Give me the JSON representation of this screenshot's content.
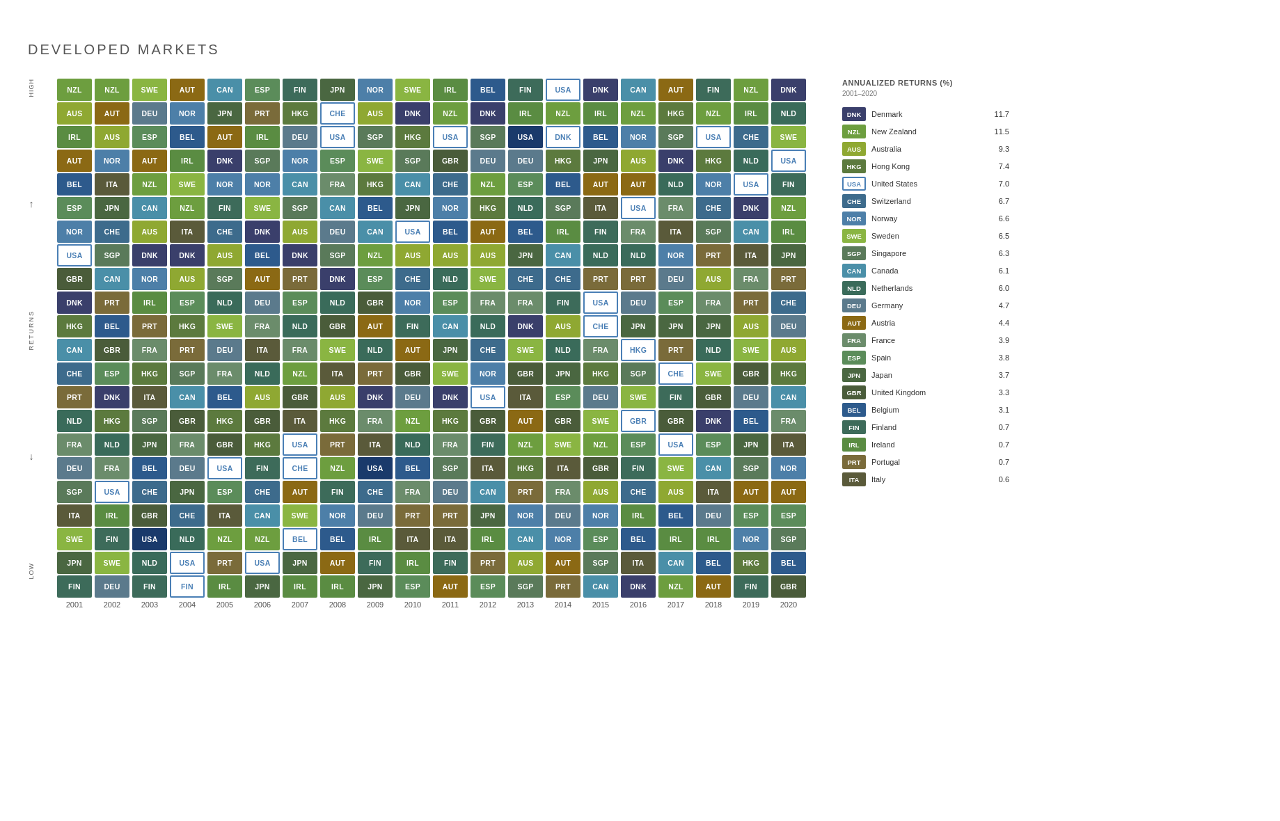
{
  "title": "DEVELOPED MARKETS",
  "yAxis": {
    "top": "HIGH",
    "mid": "RETURNS",
    "bot": "LOW"
  },
  "xLabels": [
    "2001",
    "2002",
    "2003",
    "2004",
    "2005",
    "2006",
    "2007",
    "2008",
    "2009",
    "2010",
    "2011",
    "2012",
    "2013",
    "2014",
    "2015",
    "2016",
    "2017",
    "2018",
    "2019",
    "2020"
  ],
  "legend": {
    "title": "ANNUALIZED RETURNS (%)",
    "subtitle": "2001–2020",
    "items": [
      {
        "code": "DNK",
        "name": "Denmark",
        "value": "11.7",
        "color": "#3a3f6b"
      },
      {
        "code": "NZL",
        "name": "New Zealand",
        "value": "11.5",
        "color": "#6d9e3f"
      },
      {
        "code": "AUS",
        "name": "Australia",
        "value": "9.3",
        "color": "#8fa832"
      },
      {
        "code": "HKG",
        "name": "Hong Kong",
        "value": "7.4",
        "color": "#5c7a3e"
      },
      {
        "code": "USA",
        "name": "United States",
        "value": "7.0",
        "outlined": true
      },
      {
        "code": "CHE",
        "name": "Switzerland",
        "value": "6.7",
        "color": "#3d6b8c"
      },
      {
        "code": "NOR",
        "name": "Norway",
        "value": "6.6",
        "color": "#4d7fa8"
      },
      {
        "code": "SWE",
        "name": "Sweden",
        "value": "6.5",
        "color": "#8ab542"
      },
      {
        "code": "SGP",
        "name": "Singapore",
        "value": "6.3",
        "color": "#5a7a5a"
      },
      {
        "code": "CAN",
        "name": "Canada",
        "value": "6.1",
        "color": "#4a8fa8"
      },
      {
        "code": "NLD",
        "name": "Netherlands",
        "value": "6.0",
        "color": "#3a6b5a"
      },
      {
        "code": "DEU",
        "name": "Germany",
        "value": "4.7",
        "color": "#5b7a8c"
      },
      {
        "code": "AUT",
        "name": "Austria",
        "value": "4.4",
        "color": "#8b6914"
      },
      {
        "code": "FRA",
        "name": "France",
        "value": "3.9",
        "color": "#6b8c6b"
      },
      {
        "code": "ESP",
        "name": "Spain",
        "value": "3.8",
        "color": "#5b8c5a"
      },
      {
        "code": "JPN",
        "name": "Japan",
        "value": "3.7",
        "color": "#4a6741"
      },
      {
        "code": "GBR",
        "name": "United Kingdom",
        "value": "3.3",
        "color": "#4a5c3a"
      },
      {
        "code": "BEL",
        "name": "Belgium",
        "value": "3.1",
        "color": "#2d5a8c"
      },
      {
        "code": "FIN",
        "name": "Finland",
        "value": "0.7",
        "color": "#3d6b5a"
      },
      {
        "code": "IRL",
        "name": "Ireland",
        "value": "0.7",
        "color": "#5a8c42"
      },
      {
        "code": "PRT",
        "name": "Portugal",
        "value": "0.7",
        "color": "#7a6b3a"
      },
      {
        "code": "ITA",
        "name": "Italy",
        "value": "0.6",
        "color": "#5a5a3a"
      }
    ]
  },
  "grid": [
    [
      "NZL",
      "NZL",
      "SWE",
      "AUT",
      "CAN",
      "ESP",
      "FIN",
      "JPN",
      "NOR",
      "SWE",
      "IRL",
      "BEL",
      "FIN",
      "USA",
      "DNK",
      "CAN",
      "AUT",
      "FIN",
      "NZL",
      "DNK"
    ],
    [
      "AUS",
      "AUT",
      "DEU",
      "NOR",
      "JPN",
      "PRT",
      "HKG",
      "CHE",
      "AUS",
      "DNK",
      "NZL",
      "DNK",
      "IRL",
      "NZL",
      "IRL",
      "NZL",
      "HKG",
      "NZL",
      "IRL",
      "NLD"
    ],
    [
      "IRL",
      "AUS",
      "ESP",
      "BEL",
      "AUT",
      "IRL",
      "DEU",
      "USA",
      "SGP",
      "HKG",
      "USA",
      "SGP",
      "USA",
      "DNK",
      "BEL",
      "NOR",
      "SGP",
      "USA",
      "CHE",
      "SWE"
    ],
    [
      "AUT",
      "NOR",
      "AUT",
      "IRL",
      "DNK",
      "SGP",
      "NOR",
      "ESP",
      "SWE",
      "SGP",
      "GBR",
      "DEU",
      "DEU",
      "HKG",
      "JPN",
      "AUS",
      "DNK",
      "HKG",
      "NLD",
      "USA"
    ],
    [
      "BEL",
      "ITA",
      "NZL",
      "SWE",
      "NOR",
      "NOR",
      "CAN",
      "FRA",
      "HKG",
      "CAN",
      "CHE",
      "NZL",
      "ESP",
      "BEL",
      "AUT",
      "AUT",
      "NLD",
      "NOR",
      "USA",
      "FIN"
    ],
    [
      "ESP",
      "JPN",
      "CAN",
      "NZL",
      "FIN",
      "SWE",
      "SGP",
      "CAN",
      "BEL",
      "JPN",
      "NOR",
      "HKG",
      "NLD",
      "SGP",
      "ITA",
      "USA",
      "FRA",
      "CHE",
      "DNK",
      "NZL"
    ],
    [
      "NOR",
      "CHE",
      "AUS",
      "ITA",
      "CHE",
      "DNK",
      "AUS",
      "DEU",
      "CAN",
      "USA",
      "BEL",
      "AUT",
      "BEL",
      "IRL",
      "FIN",
      "FRA",
      "ITA",
      "SGP",
      "CAN",
      "IRL"
    ],
    [
      "USA",
      "SGP",
      "DNK",
      "DNK",
      "AUS",
      "BEL",
      "DNK",
      "SGP",
      "NZL",
      "AUS",
      "AUS",
      "AUS",
      "JPN",
      "CAN",
      "NLD",
      "NLD",
      "NOR",
      "PRT",
      "ITA",
      "JPN"
    ],
    [
      "GBR",
      "CAN",
      "NOR",
      "AUS",
      "SGP",
      "AUT",
      "PRT",
      "DNK",
      "ESP",
      "CHE",
      "NLD",
      "SWE",
      "CHE",
      "CHE",
      "PRT",
      "PRT",
      "DEU",
      "AUS",
      "FRA",
      "PRT"
    ],
    [
      "DNK",
      "PRT",
      "IRL",
      "ESP",
      "NLD",
      "DEU",
      "ESP",
      "NLD",
      "GBR",
      "NOR",
      "ESP",
      "FRA",
      "FRA",
      "FIN",
      "USA",
      "DEU",
      "ESP",
      "FRA",
      "PRT",
      "CHE"
    ],
    [
      "HKG",
      "BEL",
      "PRT",
      "HKG",
      "SWE",
      "FRA",
      "NLD",
      "GBR",
      "AUT",
      "FIN",
      "CAN",
      "NLD",
      "DNK",
      "AUS",
      "CHE",
      "JPN",
      "JPN",
      "JPN",
      "AUS",
      "DEU"
    ],
    [
      "CAN",
      "GBR",
      "FRA",
      "PRT",
      "DEU",
      "ITA",
      "FRA",
      "SWE",
      "NLD",
      "AUT",
      "JPN",
      "CHE",
      "SWE",
      "NLD",
      "FRA",
      "HKG",
      "PRT",
      "NLD",
      "SWE",
      "AUS"
    ],
    [
      "CHE",
      "ESP",
      "HKG",
      "SGP",
      "FRA",
      "NLD",
      "NZL",
      "ITA",
      "PRT",
      "GBR",
      "SWE",
      "NOR",
      "GBR",
      "JPN",
      "HKG",
      "SGP",
      "CHE",
      "SWE",
      "GBR",
      "HKG"
    ],
    [
      "PRT",
      "DNK",
      "ITA",
      "CAN",
      "BEL",
      "AUS",
      "GBR",
      "AUS",
      "DNK",
      "DEU",
      "DNK",
      "USA",
      "ITA",
      "ESP",
      "DEU",
      "SWE",
      "FIN",
      "GBR",
      "DEU",
      "CAN"
    ],
    [
      "NLD",
      "HKG",
      "SGP",
      "GBR",
      "HKG",
      "GBR",
      "ITA",
      "HKG",
      "FRA",
      "NZL",
      "HKG",
      "GBR",
      "AUT",
      "GBR",
      "SWE",
      "GBR",
      "GBR",
      "DNK",
      "BEL",
      "FRA"
    ],
    [
      "FRA",
      "NLD",
      "JPN",
      "FRA",
      "GBR",
      "HKG",
      "USA",
      "PRT",
      "ITA",
      "NLD",
      "FRA",
      "FIN",
      "NZL",
      "SWE",
      "NZL",
      "ESP",
      "USA",
      "ESP",
      "JPN",
      "ITA"
    ],
    [
      "DEU",
      "FRA",
      "BEL",
      "DEU",
      "USA",
      "FIN",
      "CHE",
      "NZL",
      "USA",
      "BEL",
      "SGP",
      "ITA",
      "HKG",
      "ITA",
      "GBR",
      "FIN",
      "SWE",
      "CAN",
      "SGP",
      "NOR"
    ],
    [
      "SGP",
      "USA",
      "CHE",
      "JPN",
      "ESP",
      "CHE",
      "AUT",
      "FIN",
      "CHE",
      "FRA",
      "DEU",
      "CAN",
      "PRT",
      "FRA",
      "AUS",
      "CHE",
      "AUS",
      "ITA",
      "AUT",
      "AUT"
    ],
    [
      "ITA",
      "IRL",
      "GBR",
      "CHE",
      "ITA",
      "CAN",
      "SWE",
      "NOR",
      "DEU",
      "PRT",
      "PRT",
      "JPN",
      "NOR",
      "DEU",
      "NOR",
      "IRL",
      "BEL",
      "DEU",
      "ESP",
      "ESP"
    ],
    [
      "SWE",
      "FIN",
      "USA",
      "NLD",
      "NZL",
      "NZL",
      "BEL",
      "BEL",
      "IRL",
      "ITA",
      "ITA",
      "IRL",
      "CAN",
      "NOR",
      "ESP",
      "BEL",
      "IRL",
      "IRL",
      "NOR",
      "SGP"
    ],
    [
      "JPN",
      "SWE",
      "NLD",
      "USA",
      "PRT",
      "USA",
      "JPN",
      "AUT",
      "FIN",
      "IRL",
      "FIN",
      "PRT",
      "AUS",
      "AUT",
      "SGP",
      "ITA",
      "CAN",
      "BEL",
      "HKG",
      "BEL"
    ],
    [
      "FIN",
      "DEU",
      "FIN",
      "FIN",
      "IRL",
      "JPN",
      "IRL",
      "IRL",
      "JPN",
      "ESP",
      "AUT",
      "ESP",
      "SGP",
      "PRT",
      "CAN",
      "DNK",
      "NZL",
      "AUT",
      "FIN",
      "GBR"
    ]
  ],
  "outlinedCells": [
    [
      0,
      13
    ],
    [
      1,
      7
    ],
    [
      2,
      7
    ],
    [
      2,
      10
    ],
    [
      2,
      13
    ],
    [
      2,
      17
    ],
    [
      3,
      19
    ],
    [
      4,
      18
    ],
    [
      5,
      15
    ],
    [
      6,
      9
    ],
    [
      7,
      0
    ],
    [
      9,
      14
    ],
    [
      10,
      14
    ],
    [
      11,
      15
    ],
    [
      12,
      16
    ],
    [
      13,
      11
    ],
    [
      14,
      15
    ],
    [
      15,
      6
    ],
    [
      15,
      16
    ],
    [
      16,
      4
    ],
    [
      16,
      6
    ],
    [
      17,
      1
    ],
    [
      19,
      6
    ],
    [
      20,
      3
    ],
    [
      20,
      5
    ],
    [
      21,
      3
    ]
  ]
}
